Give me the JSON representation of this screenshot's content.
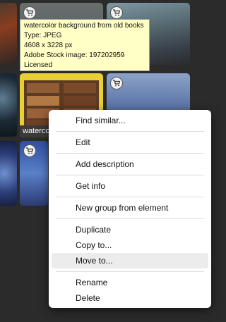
{
  "tooltip": {
    "line1": "watercolor background from old books",
    "line2": "Type: JPEG",
    "line3": "4608 x 3228 px",
    "line4": "Adobe Stock image: 197202959",
    "line5": "Licensed"
  },
  "thumbnail_label": "watercolor",
  "context_menu": {
    "find_similar": "Find similar...",
    "edit": "Edit",
    "add_description": "Add description",
    "get_info": "Get info",
    "new_group": "New group from element",
    "duplicate": "Duplicate",
    "copy_to": "Copy to...",
    "move_to": "Move to...",
    "rename": "Rename",
    "delete": "Delete"
  },
  "icons": {
    "cart": "shopping-cart-icon"
  },
  "colors": {
    "tooltip_bg": "#ffffc6",
    "menu_bg": "#ffffff",
    "canvas_bg": "#2b2b2b"
  }
}
